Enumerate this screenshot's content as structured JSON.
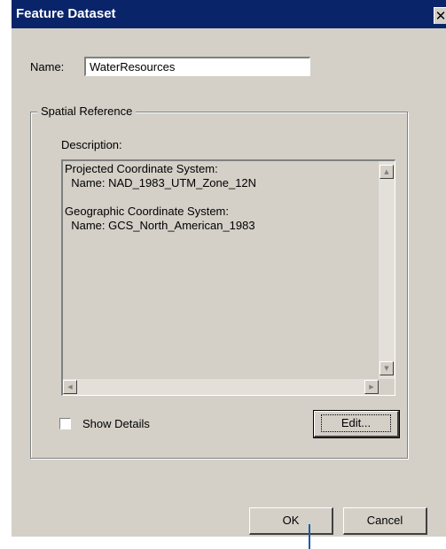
{
  "window": {
    "title": "Feature Dataset",
    "close_glyph": "✕"
  },
  "name_field": {
    "label": "Name:",
    "value": "WaterResources"
  },
  "spatial_reference": {
    "group_label": "Spatial Reference",
    "description_label": "Description:",
    "description_text": "Projected Coordinate System:\n  Name: NAD_1983_UTM_Zone_12N\n\nGeographic Coordinate System:\n  Name: GCS_North_American_1983",
    "show_details_label": "Show Details",
    "show_details_checked": false,
    "edit_button": "Edit..."
  },
  "footer": {
    "ok_button": "OK",
    "cancel_button": "Cancel"
  },
  "colors": {
    "title_bar": "#0a246a",
    "dialog_face": "#d4d0c8",
    "callout_line": "#1a5aa8"
  }
}
